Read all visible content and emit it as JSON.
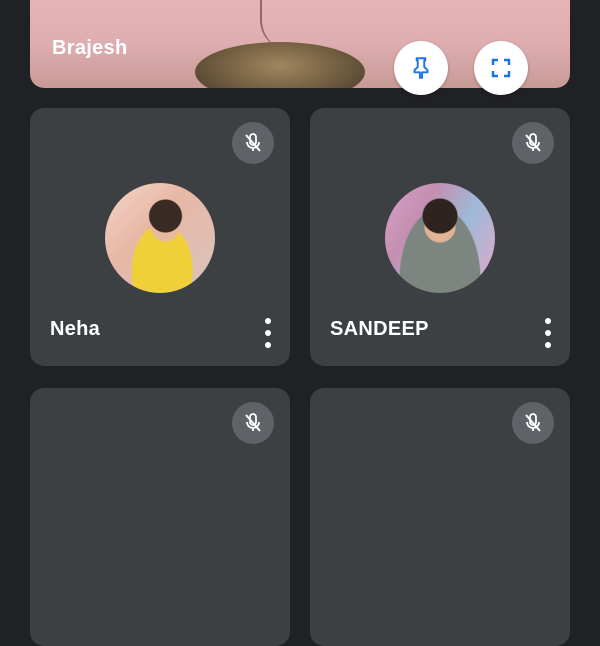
{
  "top_tile": {
    "name": "Brajesh",
    "pin_icon": "pin-icon",
    "fullscreen_icon": "fullscreen-icon"
  },
  "participants": [
    {
      "name": "Neha",
      "mic": "mic-off-icon",
      "menu": "more-vert-icon"
    },
    {
      "name": "SANDEEP",
      "mic": "mic-off-icon",
      "menu": "more-vert-icon"
    },
    {
      "mic": "mic-off-icon"
    },
    {
      "mic": "mic-off-icon"
    }
  ],
  "colors": {
    "background": "#202124",
    "tile": "#3c4043",
    "mute_badge": "#5f6368",
    "accent_blue": "#1a73e8"
  }
}
